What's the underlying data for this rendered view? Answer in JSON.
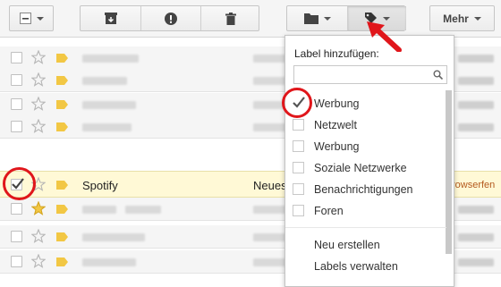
{
  "toolbar": {
    "buttons": [
      {
        "name": "select-all-checkbox",
        "icon": "checkbox-minus-icon"
      },
      {
        "name": "archive",
        "icon": "archive-icon"
      },
      {
        "name": "report-spam",
        "icon": "exclamation-icon"
      },
      {
        "name": "delete",
        "icon": "trash-icon"
      },
      {
        "name": "move-to",
        "icon": "folder-icon"
      },
      {
        "name": "labels",
        "icon": "tag-icon"
      }
    ],
    "more_label": "Mehr"
  },
  "rows": [
    {
      "sender": "",
      "subject": "",
      "snippet": "",
      "starred": false,
      "checked": false
    },
    {
      "sender": "",
      "subject": "",
      "snippet": "",
      "starred": false,
      "checked": false
    },
    {
      "sender": "",
      "subject": "",
      "snippet": "",
      "starred": false,
      "checked": false
    },
    {
      "sender": "",
      "subject": "",
      "snippet": "",
      "starred": false,
      "checked": false
    },
    {
      "sender": "Spotify",
      "subject": "Neues",
      "snippet": "rowserfen",
      "starred": false,
      "checked": true
    },
    {
      "sender": "",
      "subject": "",
      "snippet": "",
      "starred": true,
      "checked": false
    },
    {
      "sender": "",
      "subject": "",
      "snippet": "",
      "starred": false,
      "checked": false
    },
    {
      "sender": "",
      "subject": "",
      "snippet": "",
      "starred": false,
      "checked": false
    }
  ],
  "label_menu": {
    "header": "Label hinzufügen:",
    "search_placeholder": "",
    "items": [
      {
        "label": "Werbung",
        "checked": true
      },
      {
        "label": "Netzwelt",
        "checked": false
      },
      {
        "label": "Werbung",
        "checked": false
      },
      {
        "label": "Soziale Netzwerke",
        "checked": false
      },
      {
        "label": "Benachrichtigungen",
        "checked": false
      },
      {
        "label": "Foren",
        "checked": false
      }
    ],
    "actions": [
      "Neu erstellen",
      "Labels verwalten"
    ]
  },
  "colors": {
    "annotation_red": "#e0161b",
    "label_tag_yellow": "#f2c744",
    "selected_row_bg": "#fff9d6"
  }
}
